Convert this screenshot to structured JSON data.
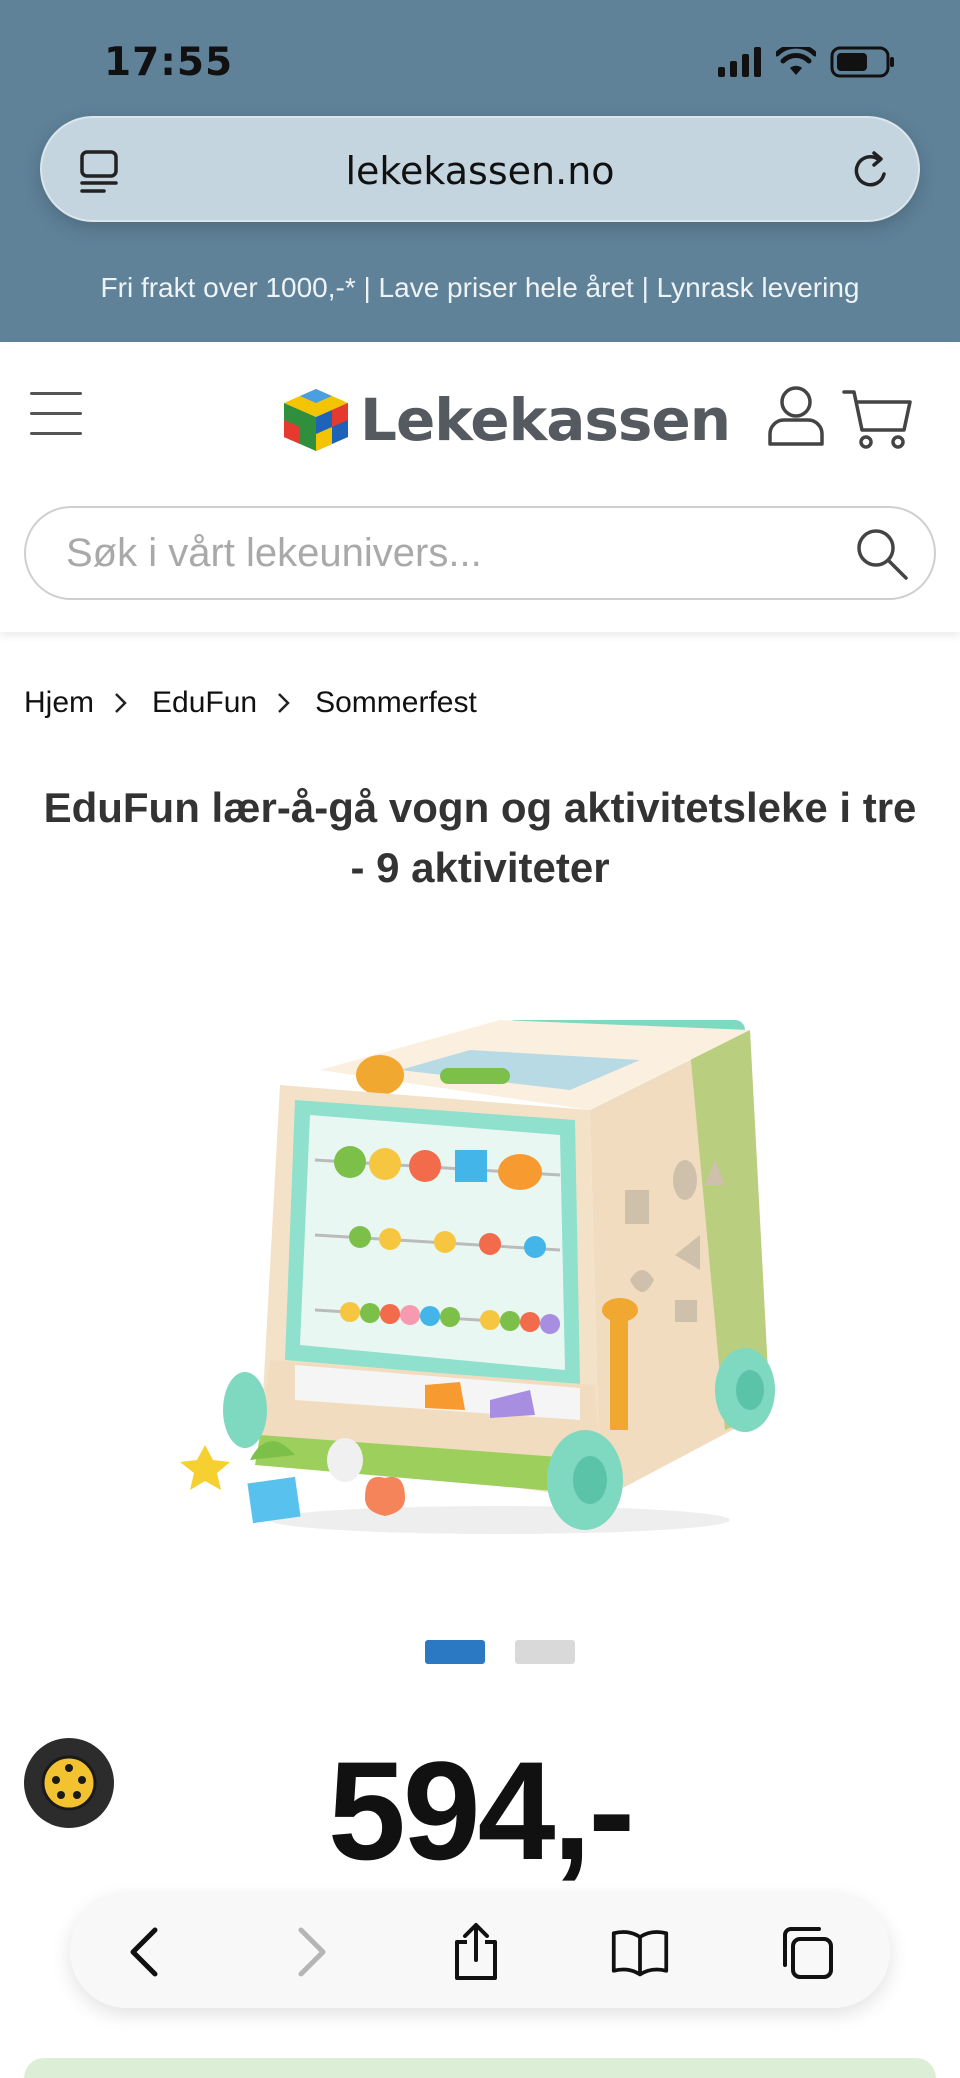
{
  "status_bar": {
    "time": "17:55"
  },
  "browser": {
    "url": "lekekassen.no"
  },
  "promo_text": "Fri frakt over 1000,-* | Lave priser hele året | Lynrask levering",
  "header": {
    "logo_text": "Lekekassen"
  },
  "search": {
    "placeholder": "Søk i vårt lekeunivers..."
  },
  "breadcrumb": [
    {
      "label": "Hjem"
    },
    {
      "label": "EduFun"
    },
    {
      "label": "Sommerfest"
    }
  ],
  "product": {
    "title": "EduFun lær-å-gå vogn og aktivitetsleke i tre - 9 aktiviteter",
    "price": "594,-",
    "image_count": 2,
    "active_image": 1
  },
  "icons": {
    "menu": "hamburger-icon",
    "user": "user-icon",
    "cart": "cart-icon",
    "search": "search-icon",
    "reload": "reload-icon",
    "reader": "reader-icon",
    "cookie": "cookie-icon",
    "back": "chevron-left-icon",
    "forward": "chevron-right-icon",
    "share": "share-icon",
    "bookmarks": "book-icon",
    "tabs": "tabs-icon"
  },
  "colors": {
    "topbar": "#5f8299",
    "accent_blue": "#2b79c2",
    "green_strip": "#dcefd6"
  }
}
